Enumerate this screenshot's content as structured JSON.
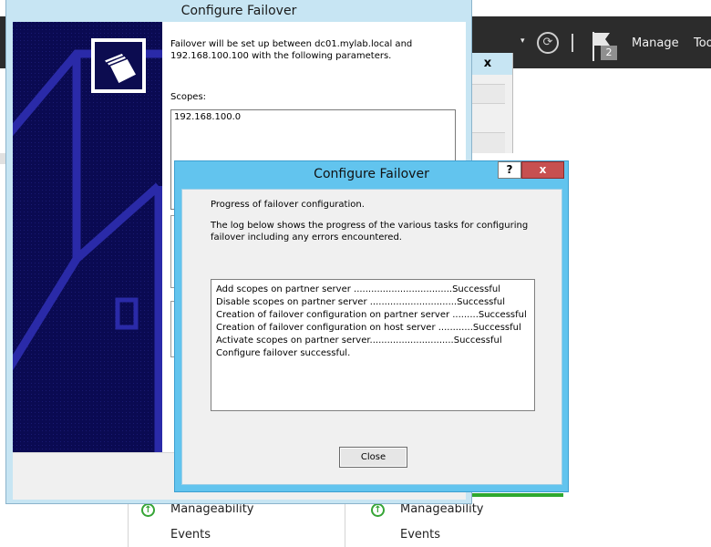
{
  "server_manager": {
    "toolbar": {
      "dropdown_arrow": "▾",
      "refresh_icon": "refresh-icon",
      "flag_icon": "notifications-flag-icon",
      "notification_count": "2",
      "manage_label": "Manage",
      "tools_label": "Too"
    },
    "tiles": [
      {
        "manageability_label": "Manageability",
        "events_label": "Events"
      },
      {
        "manageability_label": "Manageability",
        "events_label": "Events"
      }
    ]
  },
  "wizard": {
    "title": "Configure Failover",
    "intro": "Failover will be set up between dc01.mylab.local and 192.168.100.100 with the following parameters.",
    "scopes_label": "Scopes:",
    "scopes": [
      "192.168.100.0"
    ]
  },
  "mid_window": {
    "close_label": "x"
  },
  "dialog": {
    "title": "Configure Failover",
    "help_label": "?",
    "close_label": "x",
    "heading": "Progress of failover configuration.",
    "description": "The log below shows the progress of the various tasks for configuring failover including any errors encountered.",
    "log": [
      "Add scopes on partner server ..................................Successful",
      "Disable scopes on partner server ..............................Successful",
      "Creation of failover configuration on partner server .........Successful",
      "Creation of failover configuration on host server ............Successful",
      "Activate scopes on partner server.............................Successful",
      "Configure failover successful."
    ],
    "close_button_label": "Close"
  },
  "colors": {
    "dialog_frame": "#62c4ee",
    "wizard_frame": "#c7e5f3",
    "close_button": "#c75050",
    "wizard_side_panel": "#0a0a52",
    "topbar": "#2c2c2c",
    "status_green": "#36a536"
  }
}
